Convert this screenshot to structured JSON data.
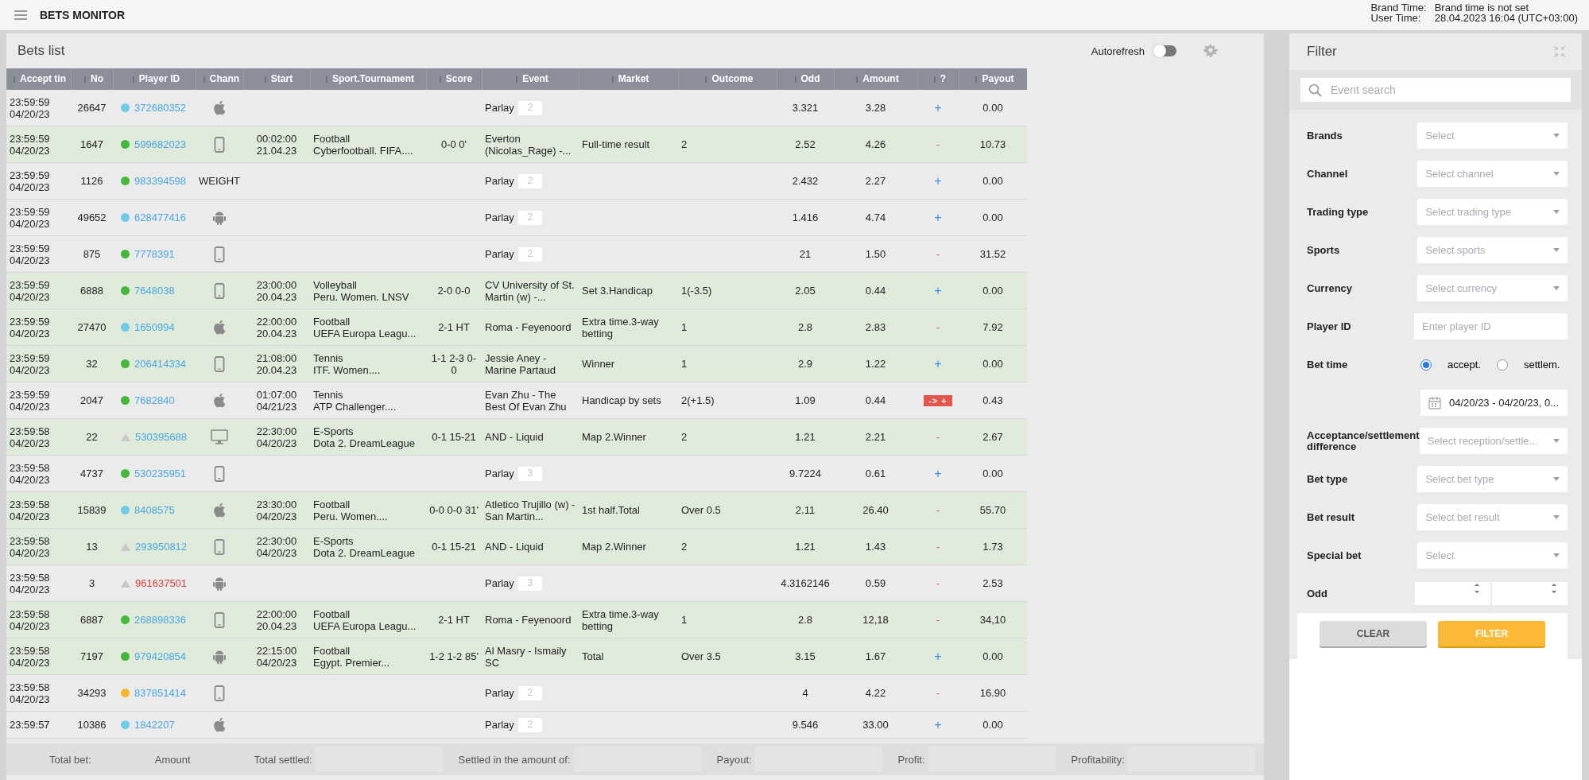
{
  "header": {
    "title": "BETS MONITOR",
    "brand_time_label": "Brand Time:",
    "brand_time_value": "Brand time is not set",
    "user_time_label": "User Time:",
    "user_time_value": "28.04.2023 16:04 (UTC+03:00)"
  },
  "bets": {
    "title": "Bets list",
    "autorefresh": {
      "label": "Autorefresh",
      "on": false
    },
    "columns": [
      "Accept tin",
      "No",
      "Player ID",
      "Chann",
      "Start",
      "Sport.Tournament",
      "Score",
      "Event",
      "Market",
      "Outcome",
      "Odd",
      "Amount",
      "?",
      "Payout"
    ],
    "rows": [
      {
        "accept_time": "23:59:59",
        "accept_date": "04/20/23",
        "no": "26647",
        "status": {
          "kind": "dot",
          "color": "#6ecbe6"
        },
        "player_id": "372680352",
        "player_alert": false,
        "channel": {
          "kind": "apple"
        },
        "live": false,
        "event": {
          "kind": "parlay",
          "label": "Parlay",
          "count": "2"
        },
        "odd": "3.321",
        "amount": "3.28",
        "result": {
          "kind": "plus",
          "text": "+"
        },
        "payout": "0.00"
      },
      {
        "accept_time": "23:59:59",
        "accept_date": "04/20/23",
        "no": "1647",
        "status": {
          "kind": "dot",
          "color": "#43b83a"
        },
        "player_id": "599682023",
        "player_alert": false,
        "channel": {
          "kind": "mobile"
        },
        "live": true,
        "start_time": "00:02:00",
        "start_date": "21.04.23",
        "sport": "Football",
        "tournament": "Cyberfootball. FIFA....",
        "score": "0-0 0'",
        "event": {
          "kind": "single",
          "label": "Everton (Nicolas_Rage) -..."
        },
        "market": "Full-time result",
        "outcome": "2",
        "odd": "2.52",
        "amount": "4.26",
        "result": {
          "kind": "minus",
          "text": "-"
        },
        "payout": "10.73"
      },
      {
        "accept_time": "23:59:59",
        "accept_date": "04/20/23",
        "no": "1126",
        "status": {
          "kind": "dot",
          "color": "#43b83a"
        },
        "player_id": "983394598",
        "player_alert": false,
        "channel": {
          "kind": "text",
          "label": "WEIGHT"
        },
        "live": false,
        "event": {
          "kind": "parlay",
          "label": "Parlay",
          "count": "2"
        },
        "odd": "2.432",
        "amount": "2.27",
        "result": {
          "kind": "plus",
          "text": "+"
        },
        "payout": "0.00"
      },
      {
        "accept_time": "23:59:59",
        "accept_date": "04/20/23",
        "no": "49652",
        "status": {
          "kind": "dot",
          "color": "#6ecbe6"
        },
        "player_id": "628477416",
        "player_alert": false,
        "channel": {
          "kind": "android"
        },
        "live": false,
        "event": {
          "kind": "parlay",
          "label": "Parlay",
          "count": "2"
        },
        "odd": "1.416",
        "amount": "4.74",
        "result": {
          "kind": "plus",
          "text": "+"
        },
        "payout": "0.00"
      },
      {
        "accept_time": "23:59:59",
        "accept_date": "04/20/23",
        "no": "875",
        "status": {
          "kind": "dot",
          "color": "#43b83a"
        },
        "player_id": "7778391",
        "player_alert": false,
        "channel": {
          "kind": "mobile"
        },
        "live": false,
        "event": {
          "kind": "parlay",
          "label": "Parlay",
          "count": "2"
        },
        "odd": "21",
        "amount": "1.50",
        "result": {
          "kind": "minus",
          "text": "-"
        },
        "payout": "31.52"
      },
      {
        "accept_time": "23:59:59",
        "accept_date": "04/20/23",
        "no": "6888",
        "status": {
          "kind": "dot",
          "color": "#43b83a"
        },
        "player_id": "7648038",
        "player_alert": false,
        "channel": {
          "kind": "mobile"
        },
        "live": true,
        "start_time": "23:00:00",
        "start_date": "20.04.23",
        "sport": "Volleyball",
        "tournament": "Peru. Women. LNSV",
        "score": "2-0 0-0",
        "event": {
          "kind": "single",
          "label": "CV University of St. Martin (w) -..."
        },
        "market": "Set 3.Handicap",
        "outcome": "1(-3.5)",
        "odd": "2.05",
        "amount": "0.44",
        "result": {
          "kind": "plus",
          "text": "+"
        },
        "payout": "0.00"
      },
      {
        "accept_time": "23:59:59",
        "accept_date": "04/20/23",
        "no": "27470",
        "status": {
          "kind": "dot",
          "color": "#6ecbe6"
        },
        "player_id": "1650994",
        "player_alert": false,
        "channel": {
          "kind": "apple"
        },
        "live": true,
        "start_time": "22:00:00",
        "start_date": "20.04.23",
        "sport": "Football",
        "tournament": "UEFA Europa Leagu...",
        "score": "2-1 HT",
        "event": {
          "kind": "single",
          "label": "Roma - Feyenoord"
        },
        "market": "Extra time.3-way betting",
        "outcome": "1",
        "odd": "2.8",
        "amount": "2.83",
        "result": {
          "kind": "minus",
          "text": "-"
        },
        "payout": "7.92"
      },
      {
        "accept_time": "23:59:59",
        "accept_date": "04/20/23",
        "no": "32",
        "status": {
          "kind": "dot",
          "color": "#43b83a"
        },
        "player_id": "206414334",
        "player_alert": false,
        "channel": {
          "kind": "mobile"
        },
        "live": true,
        "start_time": "21:08:00",
        "start_date": "20.04.23",
        "sport": "Tennis",
        "tournament": "ITF. Women....",
        "score": "1-1 2-3 0-0",
        "event": {
          "kind": "single",
          "label": "Jessie Aney - Marine Partaud"
        },
        "market": "Winner",
        "outcome": "1",
        "odd": "2.9",
        "amount": "1.22",
        "result": {
          "kind": "plus",
          "text": "+"
        },
        "payout": "0.00"
      },
      {
        "accept_time": "23:59:59",
        "accept_date": "04/20/23",
        "no": "2047",
        "status": {
          "kind": "dot",
          "color": "#43b83a"
        },
        "player_id": "7682840",
        "player_alert": false,
        "channel": {
          "kind": "apple"
        },
        "live": false,
        "start_time": "01:07:00",
        "start_date": "04/21/23",
        "sport": "Tennis",
        "tournament": "ATP Challenger....",
        "event": {
          "kind": "single",
          "label": "Evan Zhu - The Best Of Evan Zhu"
        },
        "market": "Handicap by sets",
        "outcome": "2(+1.5)",
        "odd": "1.09",
        "amount": "0.44",
        "result": {
          "kind": "changed",
          "text": "-> +"
        },
        "payout": "0.43"
      },
      {
        "accept_time": "23:59:58",
        "accept_date": "04/20/23",
        "no": "22",
        "status": {
          "kind": "triangle",
          "color": "#c8c8c8"
        },
        "player_id": "530395688",
        "player_alert": false,
        "channel": {
          "kind": "desktop"
        },
        "live": true,
        "start_time": "22:30:00",
        "start_date": "04/20/23",
        "sport": "E-Sports",
        "tournament": "Dota 2. DreamLeague",
        "score": "0-1 15-21",
        "event": {
          "kind": "single",
          "label": "AND - Liquid"
        },
        "market": "Map 2.Winner",
        "outcome": "2",
        "odd": "1.21",
        "amount": "2.21",
        "result": {
          "kind": "minus",
          "text": "-"
        },
        "payout": "2.67"
      },
      {
        "accept_time": "23:59:58",
        "accept_date": "04/20/23",
        "no": "4737",
        "status": {
          "kind": "dot",
          "color": "#43b83a"
        },
        "player_id": "530235951",
        "player_alert": false,
        "channel": {
          "kind": "mobile"
        },
        "live": false,
        "event": {
          "kind": "parlay",
          "label": "Parlay",
          "count": "3"
        },
        "odd": "9.7224",
        "amount": "0.61",
        "result": {
          "kind": "plus",
          "text": "+"
        },
        "payout": "0.00"
      },
      {
        "accept_time": "23:59:58",
        "accept_date": "04/20/23",
        "no": "15839",
        "status": {
          "kind": "dot",
          "color": "#6ecbe6"
        },
        "player_id": "8408575",
        "player_alert": false,
        "channel": {
          "kind": "apple"
        },
        "live": true,
        "start_time": "23:30:00",
        "start_date": "04/20/23",
        "sport": "Football",
        "tournament": "Peru. Women....",
        "score": "0-0 0-0 31'",
        "event": {
          "kind": "single",
          "label": "Atletico Trujillo (w) - San Martin..."
        },
        "market": "1st half.Total",
        "outcome": "Over 0.5",
        "odd": "2.11",
        "amount": "26.40",
        "result": {
          "kind": "minus",
          "text": "-"
        },
        "payout": "55.70"
      },
      {
        "accept_time": "23:59:58",
        "accept_date": "04/20/23",
        "no": "13",
        "status": {
          "kind": "triangle",
          "color": "#c8c8c8"
        },
        "player_id": "293950812",
        "player_alert": false,
        "channel": {
          "kind": "mobile"
        },
        "live": true,
        "start_time": "22:30:00",
        "start_date": "04/20/23",
        "sport": "E-Sports",
        "tournament": "Dota 2. DreamLeague",
        "score": "0-1 15-21",
        "event": {
          "kind": "single",
          "label": "AND - Liquid"
        },
        "market": "Map 2.Winner",
        "outcome": "2",
        "odd": "1.21",
        "amount": "1.43",
        "result": {
          "kind": "minus",
          "text": "-"
        },
        "payout": "1.73"
      },
      {
        "accept_time": "23:59:58",
        "accept_date": "04/20/23",
        "no": "3",
        "status": {
          "kind": "triangle",
          "color": "#c8c8c8"
        },
        "player_id": "961637501",
        "player_alert": true,
        "channel": {
          "kind": "android"
        },
        "live": false,
        "event": {
          "kind": "parlay",
          "label": "Parlay",
          "count": "3"
        },
        "odd": "4.3162146",
        "amount": "0.59",
        "result": {
          "kind": "minus",
          "text": "-"
        },
        "payout": "2.53"
      },
      {
        "accept_time": "23:59:58",
        "accept_date": "04/20/23",
        "no": "6887",
        "status": {
          "kind": "dot",
          "color": "#43b83a"
        },
        "player_id": "268898336",
        "player_alert": false,
        "channel": {
          "kind": "mobile"
        },
        "live": true,
        "start_time": "22:00:00",
        "start_date": "20.04.23",
        "sport": "Football",
        "tournament": "UEFA Europa Leagu...",
        "score": "2-1 HT",
        "event": {
          "kind": "single",
          "label": "Roma - Feyenoord"
        },
        "market": "Extra time.3-way betting",
        "outcome": "1",
        "odd": "2.8",
        "amount": "12,18",
        "result": {
          "kind": "minus",
          "text": "-"
        },
        "payout": "34,10"
      },
      {
        "accept_time": "23:59:58",
        "accept_date": "04/20/23",
        "no": "7197",
        "status": {
          "kind": "dot",
          "color": "#43b83a"
        },
        "player_id": "979420854",
        "player_alert": false,
        "channel": {
          "kind": "android"
        },
        "live": true,
        "start_time": "22:15:00",
        "start_date": "04/20/23",
        "sport": "Football",
        "tournament": "Egypt. Premier...",
        "score": "1-2 1-2 85'",
        "event": {
          "kind": "single",
          "label": "Al Masry - Ismaily SC"
        },
        "market": "Total",
        "outcome": "Over 3.5",
        "odd": "3.15",
        "amount": "1.67",
        "result": {
          "kind": "plus",
          "text": "+"
        },
        "payout": "0.00"
      },
      {
        "accept_time": "23:59:58",
        "accept_date": "04/20/23",
        "no": "34293",
        "status": {
          "kind": "dot",
          "color": "#f5b82e"
        },
        "player_id": "837851414",
        "player_alert": false,
        "channel": {
          "kind": "mobile"
        },
        "live": false,
        "event": {
          "kind": "parlay",
          "label": "Parlay",
          "count": "2"
        },
        "odd": "4",
        "amount": "4.22",
        "result": {
          "kind": "minus",
          "text": "-"
        },
        "payout": "16.90"
      },
      {
        "accept_time": "23:59:57",
        "no": "10386",
        "status": {
          "kind": "dot",
          "color": "#6ecbe6"
        },
        "player_id": "1842207",
        "player_alert": false,
        "channel": {
          "kind": "apple"
        },
        "live": false,
        "event": {
          "kind": "parlay",
          "label": "Parlay",
          "count": "2"
        },
        "odd": "9.546",
        "amount": "33.00",
        "result": {
          "kind": "plus",
          "text": "+"
        },
        "payout": "0.00"
      }
    ],
    "footer": [
      {
        "label": "Total bet:",
        "boxed": false
      },
      {
        "label": "Amount",
        "boxed": false
      },
      {
        "label": "Total settled:",
        "boxed": true
      },
      {
        "label": "Settled in the amount of:",
        "boxed": true
      },
      {
        "label": "Payout:",
        "boxed": true
      },
      {
        "label": "Profit:",
        "boxed": true
      },
      {
        "label": "Profitability:",
        "boxed": true
      }
    ]
  },
  "filter": {
    "title": "Filter",
    "search": {
      "placeholder": "Event search"
    },
    "fields": [
      {
        "kind": "select",
        "label": "Brands",
        "placeholder": "Select"
      },
      {
        "kind": "select",
        "label": "Channel",
        "placeholder": "Select channel"
      },
      {
        "kind": "select",
        "label": "Trading type",
        "placeholder": "Select trading type"
      },
      {
        "kind": "select",
        "label": "Sports",
        "placeholder": "Select sports"
      },
      {
        "kind": "select",
        "label": "Currency",
        "placeholder": "Select currency"
      },
      {
        "kind": "input",
        "label": "Player ID",
        "placeholder": "Enter player ID"
      },
      {
        "kind": "radio",
        "label": "Bet time",
        "options": [
          {
            "label": "accept.",
            "selected": true
          },
          {
            "label": "settlem.",
            "selected": false
          }
        ]
      },
      {
        "kind": "date",
        "value": "04/20/23 - 04/20/23, 0..."
      },
      {
        "kind": "select",
        "label": "Acceptance/settlement difference",
        "placeholder": "Select reception/settle..."
      },
      {
        "kind": "select",
        "label": "Bet type",
        "placeholder": "Select bet type"
      },
      {
        "kind": "select",
        "label": "Bet result",
        "placeholder": "Select bet result"
      },
      {
        "kind": "select",
        "label": "Special bet",
        "placeholder": "Select"
      },
      {
        "kind": "range",
        "label": "Odd"
      }
    ],
    "buttons": [
      {
        "kind": "secondary",
        "label": "CLEAR"
      },
      {
        "kind": "primary",
        "label": "FILTER"
      }
    ]
  }
}
